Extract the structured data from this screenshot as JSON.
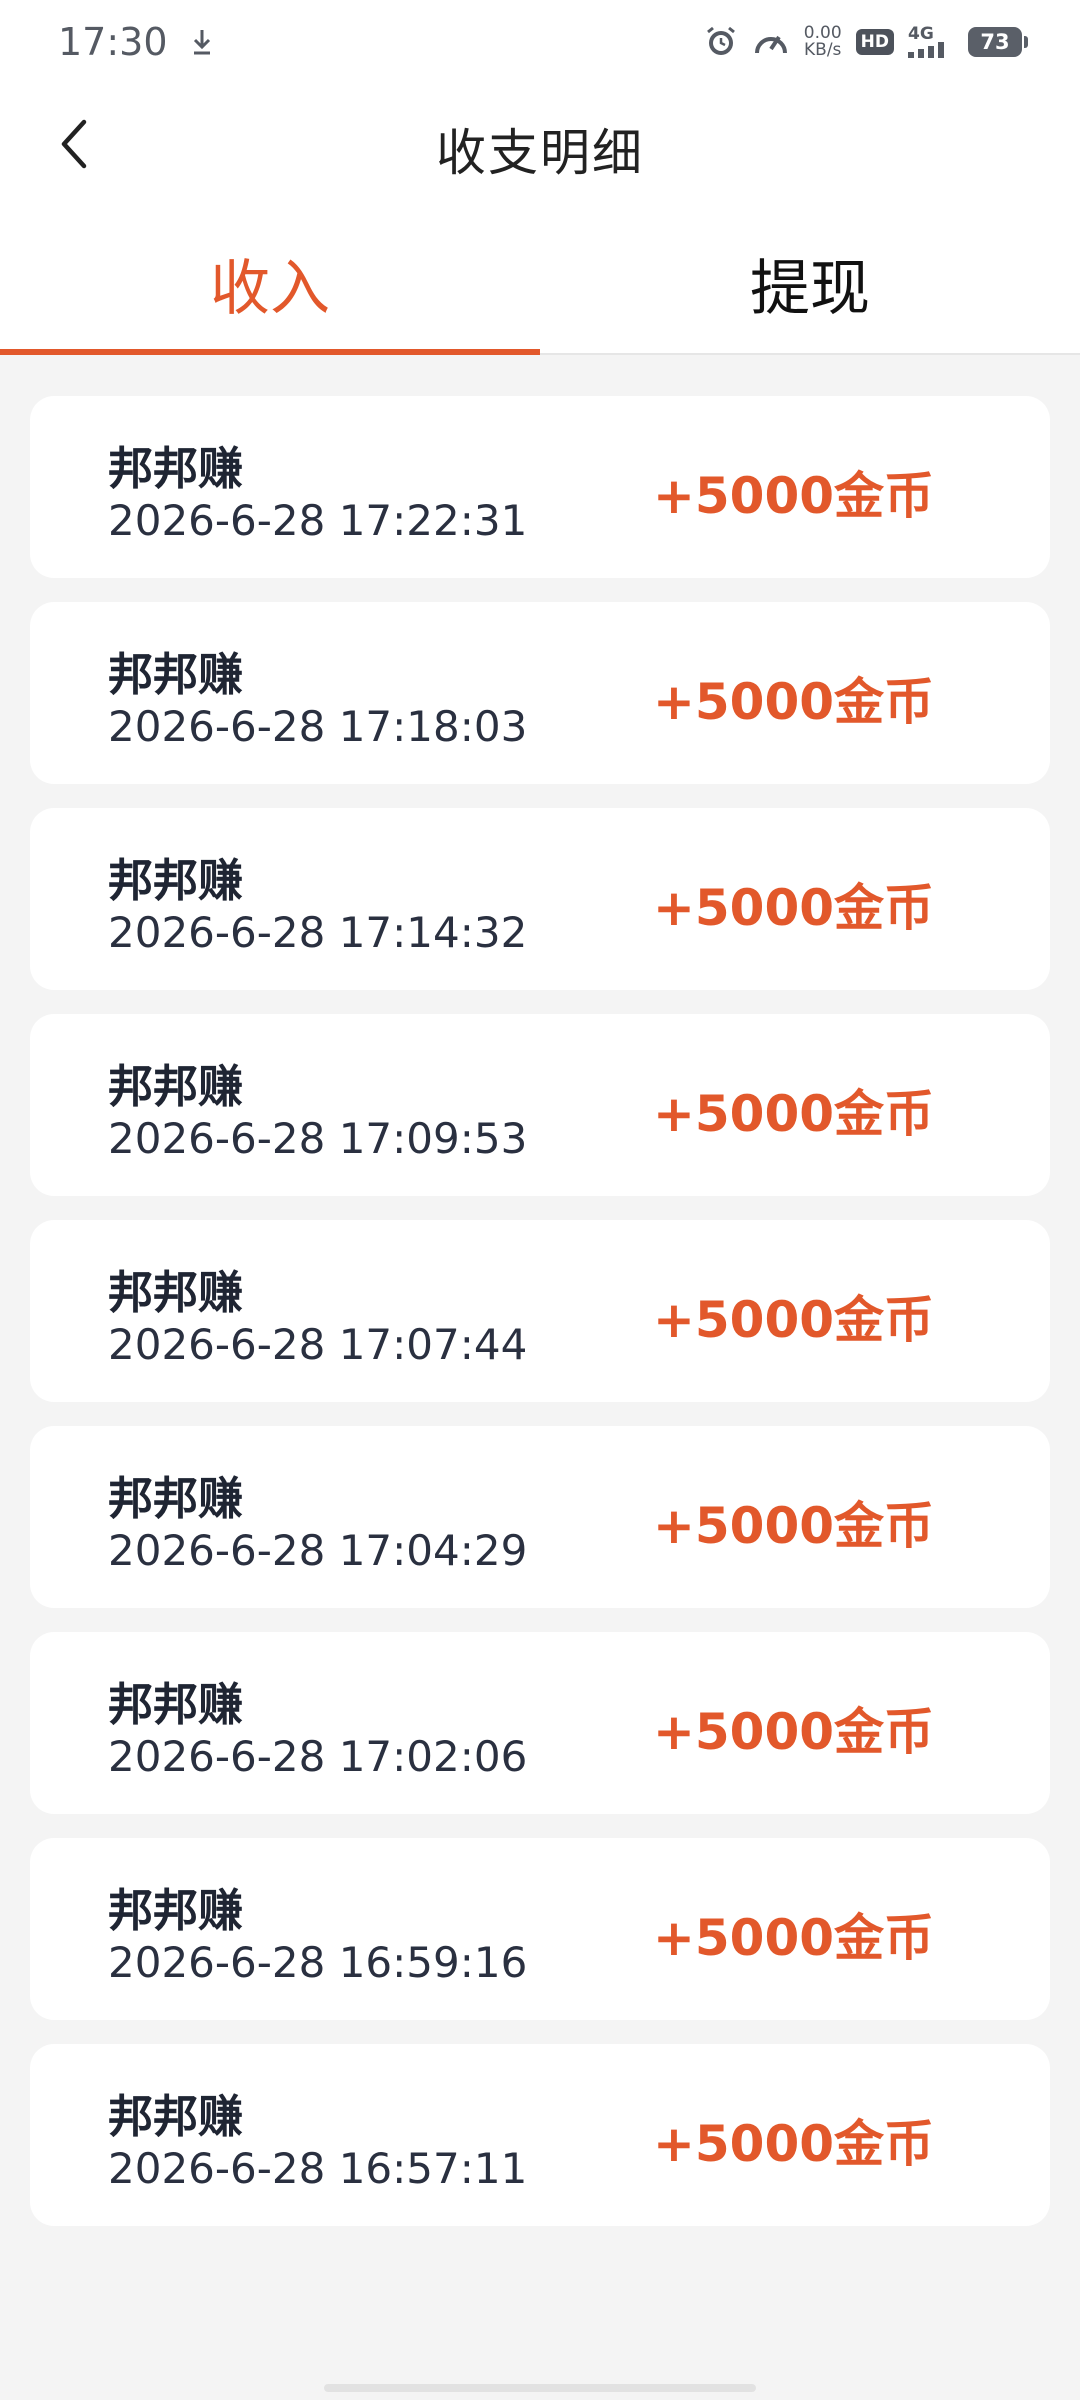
{
  "status_bar": {
    "time": "17:30",
    "net_speed_value": "0.00",
    "net_speed_unit": "KB/s",
    "hd_badge": "HD",
    "signal_label": "4G",
    "battery": "73"
  },
  "header": {
    "title": "收支明细"
  },
  "tabs": [
    {
      "label": "收入",
      "active": true
    },
    {
      "label": "提现",
      "active": false
    }
  ],
  "records": [
    {
      "name": "邦邦赚",
      "time": "2026-6-28 17:22:31",
      "amount": "+5000金币"
    },
    {
      "name": "邦邦赚",
      "time": "2026-6-28 17:18:03",
      "amount": "+5000金币"
    },
    {
      "name": "邦邦赚",
      "time": "2026-6-28 17:14:32",
      "amount": "+5000金币"
    },
    {
      "name": "邦邦赚",
      "time": "2026-6-28 17:09:53",
      "amount": "+5000金币"
    },
    {
      "name": "邦邦赚",
      "time": "2026-6-28 17:07:44",
      "amount": "+5000金币"
    },
    {
      "name": "邦邦赚",
      "time": "2026-6-28 17:04:29",
      "amount": "+5000金币"
    },
    {
      "name": "邦邦赚",
      "time": "2026-6-28 17:02:06",
      "amount": "+5000金币"
    },
    {
      "name": "邦邦赚",
      "time": "2026-6-28 16:59:16",
      "amount": "+5000金币"
    },
    {
      "name": "邦邦赚",
      "time": "2026-6-28 16:57:11",
      "amount": "+5000金币"
    }
  ],
  "colors": {
    "accent": "#e2582b",
    "background": "#f4f4f4",
    "card": "#ffffff"
  }
}
